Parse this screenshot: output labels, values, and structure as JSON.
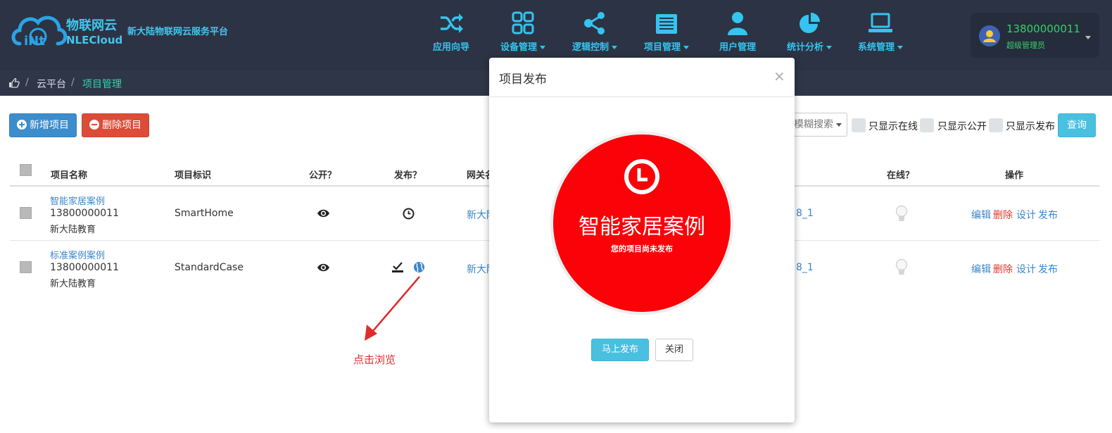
{
  "header": {
    "brand_cn": "物联网云",
    "brand_en": "NLECloud",
    "slogan": "新大陆物联网云服务平台",
    "logo_text": "iNt",
    "nav": [
      {
        "label": "应用向导",
        "icon": "shuffle-icon",
        "dropdown": false
      },
      {
        "label": "设备管理",
        "icon": "grid-icon",
        "dropdown": true
      },
      {
        "label": "逻辑控制",
        "icon": "share-nodes-icon",
        "dropdown": true
      },
      {
        "label": "项目管理",
        "icon": "server-stack-icon",
        "dropdown": true
      },
      {
        "label": "用户管理",
        "icon": "user-icon",
        "dropdown": false
      },
      {
        "label": "统计分析",
        "icon": "pie-chart-icon",
        "dropdown": true
      },
      {
        "label": "系统管理",
        "icon": "laptop-icon",
        "dropdown": true
      }
    ],
    "user": {
      "phone": "13800000011",
      "role": "超级管理员"
    }
  },
  "breadcrumb": {
    "sep": "/",
    "items": [
      "云平台",
      "项目管理"
    ]
  },
  "toolbar": {
    "add_label": "新增项目",
    "delete_label": "删除项目",
    "search_mode": "模糊搜索",
    "filters": [
      "只显示在线",
      "只显示公开",
      "只显示发布"
    ],
    "query_label": "查询"
  },
  "table": {
    "headers": {
      "name": "项目名称",
      "tag": "项目标识",
      "public": "公开？",
      "publish": "发布？",
      "gateway": "网关名",
      "online": "在线？",
      "actions": "操作"
    },
    "rows": [
      {
        "name": "智能家居案例",
        "owner": "13800000011",
        "org": "新大陆教育",
        "tag": "SmartHome",
        "gateway": "新大陆",
        "device": "8_1",
        "publish_state": "unpublished"
      },
      {
        "name": "标准案例案例",
        "owner": "13800000011",
        "org": "新大陆教育",
        "tag": "StandardCase",
        "gateway": "新大陆",
        "device": "8_1",
        "publish_state": "published"
      }
    ],
    "actions": [
      "编辑",
      "删除",
      "设计",
      "发布"
    ]
  },
  "modal": {
    "title": "项目发布",
    "close": "×",
    "project_name": "智能家居案例",
    "status": "您的项目尚未发布",
    "publish_button": "马上发布",
    "close_button": "关闭"
  },
  "annotation": {
    "text": "点击浏览"
  },
  "colors": {
    "nav_bg": "#2c3344",
    "accent": "#35c4ef",
    "primary": "#3c8dcb",
    "danger": "#dd4b39",
    "info": "#49c0e0",
    "badge_red": "#fb0108",
    "annotation_red": "#e02c2c",
    "user_green": "#35d16a"
  }
}
